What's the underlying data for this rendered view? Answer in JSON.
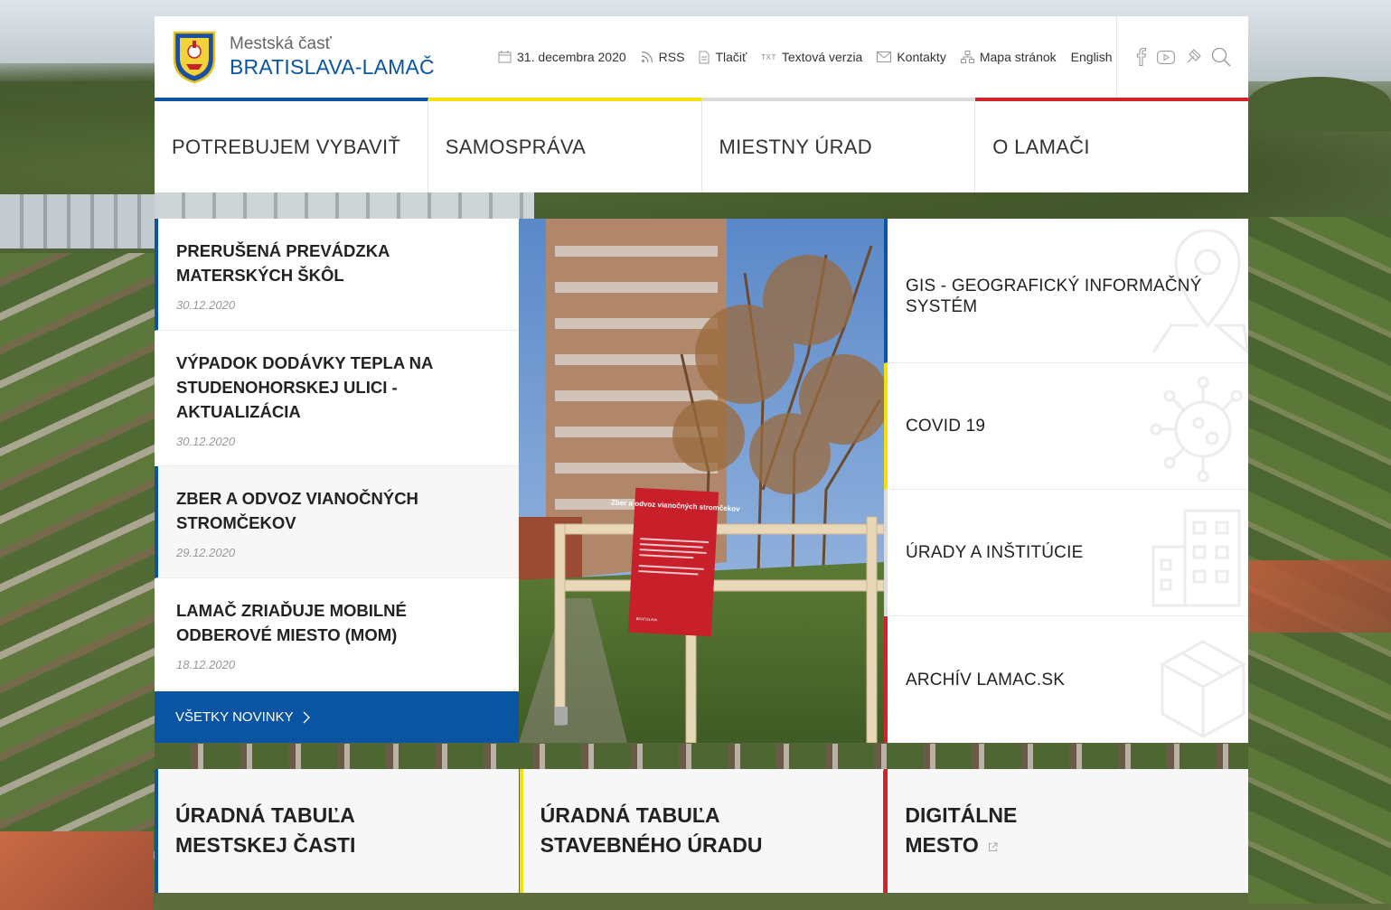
{
  "colors": {
    "blue": "#0a55a3",
    "yellow": "#f4e10a",
    "grey": "#dcdcdc",
    "red": "#d1232a"
  },
  "logo": {
    "line1": "Mestská časť",
    "line2": "BRATISLAVA-LAMAČ"
  },
  "utilities": {
    "date": "31. decembra 2020",
    "rss": "RSS",
    "print": "Tlačiť",
    "text_badge": "TXT",
    "text_version": "Textová verzia",
    "contacts": "Kontakty",
    "sitemap": "Mapa stránok",
    "english": "English"
  },
  "social": [
    "facebook-icon",
    "youtube-icon",
    "instagram-icon",
    "search-icon"
  ],
  "nav": [
    {
      "label": "POTREBUJEM VYBAVIŤ",
      "accent": "blue"
    },
    {
      "label": "SAMOSPRÁVA",
      "accent": "yellow"
    },
    {
      "label": "MIESTNY ÚRAD",
      "accent": "grey"
    },
    {
      "label": "O LAMAČI",
      "accent": "red"
    }
  ],
  "news": [
    {
      "title": "PRERUŠENÁ PREVÁDZKA MATERSKÝCH ŠKÔL",
      "date": "30.12.2020"
    },
    {
      "title": "VÝPADOK DODÁVKY TEPLA NA STUDENOHORSKEJ ULICI - AKTUALIZÁCIA",
      "date": "30.12.2020"
    },
    {
      "title": "ZBER A ODVOZ VIANOČNÝCH STROMČEKOV",
      "date": "29.12.2020"
    },
    {
      "title": "LAMAČ ZRIAĎUJE MOBILNÉ ODBEROVÉ MIESTO (MOM)",
      "date": "18.12.2020"
    }
  ],
  "all_news": "VŠETKY NOVINKY",
  "photo_sign": {
    "title": "Zber a odvoz vianočných stromčekov",
    "brand": "BRATISLAVA"
  },
  "quick_links": [
    {
      "label": "GIS - GEOGRAFICKÝ INFORMAČNÝ SYSTÉM",
      "icon": "map-pin-icon",
      "accent": "blue"
    },
    {
      "label": "COVID 19",
      "icon": "virus-icon",
      "accent": "yellow"
    },
    {
      "label": "ÚRADY A INŠTITÚCIE",
      "icon": "building-icon",
      "accent": "grey"
    },
    {
      "label": "ARCHÍV LAMAC.SK",
      "icon": "archive-box-icon",
      "accent": "red"
    }
  ],
  "bottom_tiles": [
    {
      "line1": "ÚRADNÁ TABUĽA",
      "line2": "MESTSKEJ ČASTI",
      "accent": "blue"
    },
    {
      "line1": "ÚRADNÁ TABUĽA",
      "line2": "STAVEBNÉHO ÚRADU",
      "accent": "yellow"
    },
    {
      "line1": "DIGITÁLNE",
      "line2": "MESTO",
      "accent": "red",
      "external": "external-link-icon"
    }
  ]
}
